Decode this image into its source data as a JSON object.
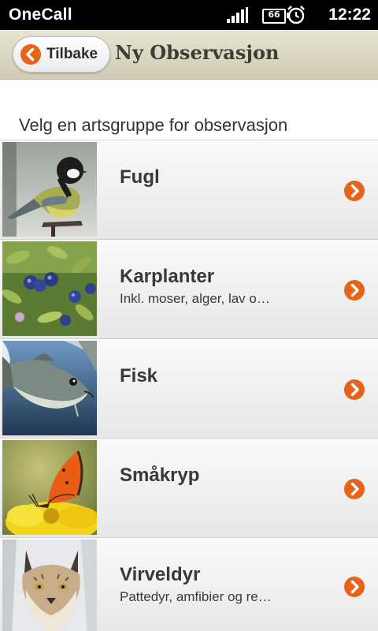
{
  "status_bar": {
    "carrier": "OneCall",
    "battery_level": "66",
    "time": "12:22",
    "icons": [
      "signal-icon",
      "battery-icon",
      "alarm-clock-icon"
    ]
  },
  "header": {
    "back_label": "Tilbake",
    "title": "Ny Observasjon"
  },
  "instruction": "Velg en artsgruppe for observasjon",
  "items": [
    {
      "title": "Fugl",
      "subtitle": "",
      "image": "great-tit-bird-photo"
    },
    {
      "title": "Karplanter",
      "subtitle": "Inkl. moser, alger, lav o…",
      "image": "blueberry-plant-photo"
    },
    {
      "title": "Fisk",
      "subtitle": "",
      "image": "cod-fish-photo"
    },
    {
      "title": "Småkryp",
      "subtitle": "",
      "image": "orange-butterfly-photo"
    },
    {
      "title": "Virveldyr",
      "subtitle": "Pattedyr, amfibier og re…",
      "image": "lynx-photo"
    }
  ],
  "colors": {
    "accent_orange": "#e8631a",
    "header_bg": "#dcd9c4",
    "title_text": "#3c3e35"
  }
}
